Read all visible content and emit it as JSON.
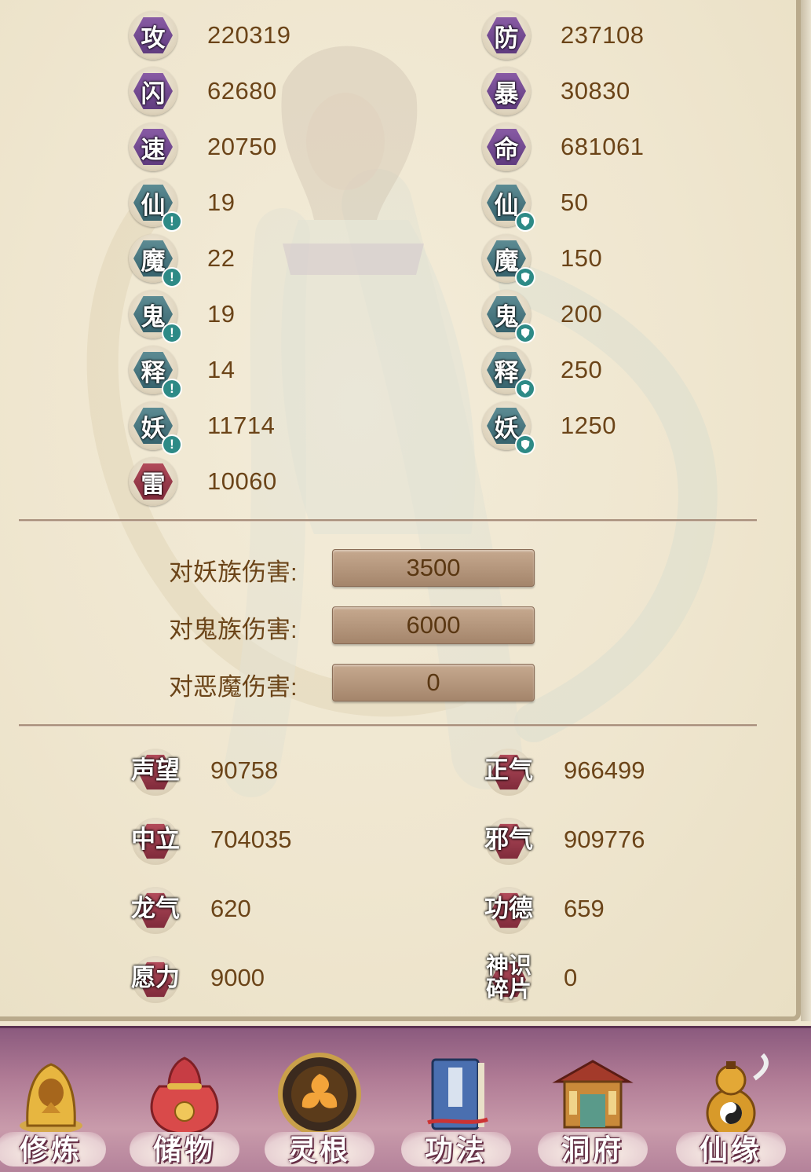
{
  "stats_left": [
    {
      "icon": "攻",
      "value": "220319",
      "style": "purple",
      "mark": ""
    },
    {
      "icon": "闪",
      "value": "62680",
      "style": "purple",
      "mark": ""
    },
    {
      "icon": "速",
      "value": "20750",
      "style": "purple",
      "mark": ""
    },
    {
      "icon": "仙",
      "value": "19",
      "style": "teal",
      "mark": "!"
    },
    {
      "icon": "魔",
      "value": "22",
      "style": "teal",
      "mark": "!"
    },
    {
      "icon": "鬼",
      "value": "19",
      "style": "teal",
      "mark": "!"
    },
    {
      "icon": "释",
      "value": "14",
      "style": "teal",
      "mark": "!"
    },
    {
      "icon": "妖",
      "value": "11714",
      "style": "teal",
      "mark": "!"
    },
    {
      "icon": "雷",
      "value": "10060",
      "style": "red",
      "mark": ""
    }
  ],
  "stats_right": [
    {
      "icon": "防",
      "value": "237108",
      "style": "purple",
      "mark": ""
    },
    {
      "icon": "暴",
      "value": "30830",
      "style": "purple",
      "mark": ""
    },
    {
      "icon": "命",
      "value": "681061",
      "style": "purple",
      "mark": ""
    },
    {
      "icon": "仙",
      "value": "50",
      "style": "teal",
      "mark": "shield"
    },
    {
      "icon": "魔",
      "value": "150",
      "style": "teal",
      "mark": "shield"
    },
    {
      "icon": "鬼",
      "value": "200",
      "style": "teal",
      "mark": "shield"
    },
    {
      "icon": "释",
      "value": "250",
      "style": "teal",
      "mark": "shield"
    },
    {
      "icon": "妖",
      "value": "1250",
      "style": "teal",
      "mark": "shield"
    }
  ],
  "damage": [
    {
      "label": "对妖族伤害:",
      "value": "3500"
    },
    {
      "label": "对鬼族伤害:",
      "value": "6000"
    },
    {
      "label": "对恶魔伤害:",
      "value": "0"
    }
  ],
  "resources_left": [
    {
      "label": "声望",
      "value": "90758"
    },
    {
      "label": "中立",
      "value": "704035"
    },
    {
      "label": "龙气",
      "value": "620"
    },
    {
      "label": "愿力",
      "value": "9000"
    }
  ],
  "resources_right": [
    {
      "label": "正气",
      "value": "966499"
    },
    {
      "label": "邪气",
      "value": "909776"
    },
    {
      "label": "功德",
      "value": "659"
    },
    {
      "label": "神识碎片",
      "value": "0"
    }
  ],
  "nav": [
    {
      "label": "修炼",
      "icon": "hooded-monk-icon"
    },
    {
      "label": "储物",
      "icon": "treasure-bag-icon"
    },
    {
      "label": "灵根",
      "icon": "spirit-root-orb-icon"
    },
    {
      "label": "功法",
      "icon": "scripture-book-icon"
    },
    {
      "label": "洞府",
      "icon": "cave-mansion-icon"
    },
    {
      "label": "仙缘",
      "icon": "gourd-icon"
    }
  ],
  "colors": {
    "background": "#efe6cf",
    "value_text": "#6b4418",
    "badge_purple": "#7a4f96",
    "badge_teal": "#4a7a83",
    "badge_red": "#a03a4c",
    "navbar": "#b07b95"
  }
}
